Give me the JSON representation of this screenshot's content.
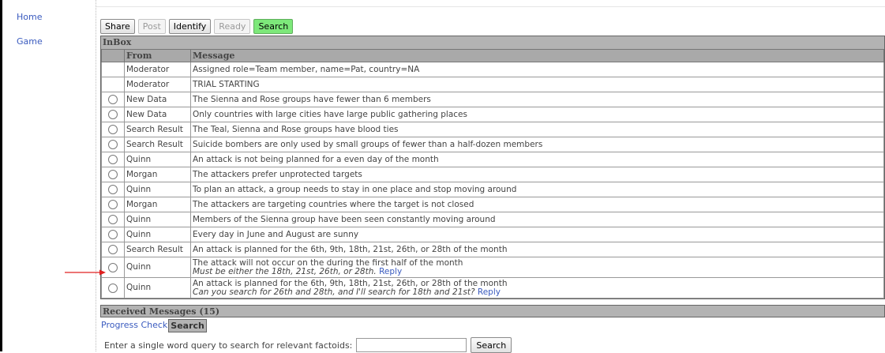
{
  "nav": {
    "home": "Home",
    "game": "Game"
  },
  "toolbar": {
    "share": "Share",
    "post": "Post",
    "identify": "Identify",
    "ready": "Ready",
    "search": "Search"
  },
  "inbox": {
    "title": "InBox",
    "col_from": "From",
    "col_message": "Message",
    "rows": [
      {
        "selectable": false,
        "from": "Moderator",
        "message": "Assigned role=Team member, name=Pat, country=NA"
      },
      {
        "selectable": false,
        "from": "Moderator",
        "message": "TRIAL STARTING"
      },
      {
        "selectable": true,
        "from": "New Data",
        "message": "The Sienna and Rose groups have fewer than 6 members"
      },
      {
        "selectable": true,
        "from": "New Data",
        "message": "Only countries with large cities have large public gathering places"
      },
      {
        "selectable": true,
        "from": "Search Result",
        "message": "The Teal, Sienna and Rose groups have blood ties"
      },
      {
        "selectable": true,
        "from": "Search Result",
        "message": "Suicide bombers are only used by small groups of fewer than a half-dozen members"
      },
      {
        "selectable": true,
        "from": "Quinn",
        "message": "An attack is not being planned for a even day of the month"
      },
      {
        "selectable": true,
        "from": "Morgan",
        "message": "The attackers prefer unprotected targets"
      },
      {
        "selectable": true,
        "from": "Quinn",
        "message": "To plan an attack, a group needs to stay in one place and stop moving around"
      },
      {
        "selectable": true,
        "from": "Morgan",
        "message": "The attackers are targeting countries where the target is not closed"
      },
      {
        "selectable": true,
        "from": "Quinn",
        "message": "Members of the Sienna group have been seen constantly moving around"
      },
      {
        "selectable": true,
        "from": "Quinn",
        "message": "Every day in June and August are sunny"
      },
      {
        "selectable": true,
        "from": "Search Result",
        "message": "An attack is planned for the 6th, 9th, 18th, 21st, 26th, or 28th of the month"
      },
      {
        "selectable": true,
        "from": "Quinn",
        "message": "The attack will not occur on the during the first half of the month",
        "note": "Must be either the 18th, 21st, 26th, or 28th.",
        "reply": "Reply"
      },
      {
        "selectable": true,
        "from": "Quinn",
        "message": "An attack is planned for the 6th, 9th, 18th, 21st, 26th, or 28th of the month",
        "note": "Can you search for 26th and 28th, and I'll search for 18th and 21st?",
        "reply": "Reply"
      }
    ]
  },
  "received": {
    "title": "Received Messages (15)"
  },
  "tabs": {
    "progress": "Progress Check",
    "search": "Search"
  },
  "search": {
    "label": "Enter a single word query to search for relevant factoids:",
    "button": "Search"
  },
  "colors": {
    "accent_green": "#7de87a",
    "link": "#3a5bbf",
    "arrow": "#e02020"
  }
}
